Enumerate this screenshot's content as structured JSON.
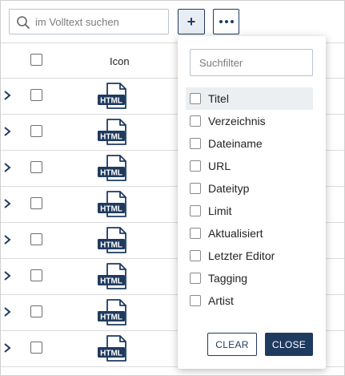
{
  "search": {
    "placeholder": "im Volltext suchen",
    "icon": "search-icon"
  },
  "toolbar": {
    "add_label": "+",
    "more_icon": "more-dots-icon"
  },
  "table": {
    "header": {
      "icon_column": "Icon"
    },
    "rows": [
      {
        "icon": "HTML"
      },
      {
        "icon": "HTML"
      },
      {
        "icon": "HTML"
      },
      {
        "icon": "HTML"
      },
      {
        "icon": "HTML"
      },
      {
        "icon": "HTML"
      },
      {
        "icon": "HTML"
      },
      {
        "icon": "HTML"
      }
    ]
  },
  "column_menu": {
    "filter_placeholder": "Suchfilter",
    "options": [
      {
        "label": "Titel",
        "checked": false,
        "highlighted": true
      },
      {
        "label": "Verzeichnis",
        "checked": false
      },
      {
        "label": "Dateiname",
        "checked": false
      },
      {
        "label": "URL",
        "checked": false
      },
      {
        "label": "Dateityp",
        "checked": false
      },
      {
        "label": "Limit",
        "checked": false
      },
      {
        "label": "Aktualisiert",
        "checked": false
      },
      {
        "label": "Letzter Editor",
        "checked": false
      },
      {
        "label": "Tagging",
        "checked": false
      },
      {
        "label": "Artist",
        "checked": false
      }
    ],
    "clear_label": "CLEAR",
    "close_label": "CLOSE"
  },
  "colors": {
    "primary": "#1f3a5f",
    "border": "#dcdcdc",
    "highlight": "#eceff2"
  }
}
